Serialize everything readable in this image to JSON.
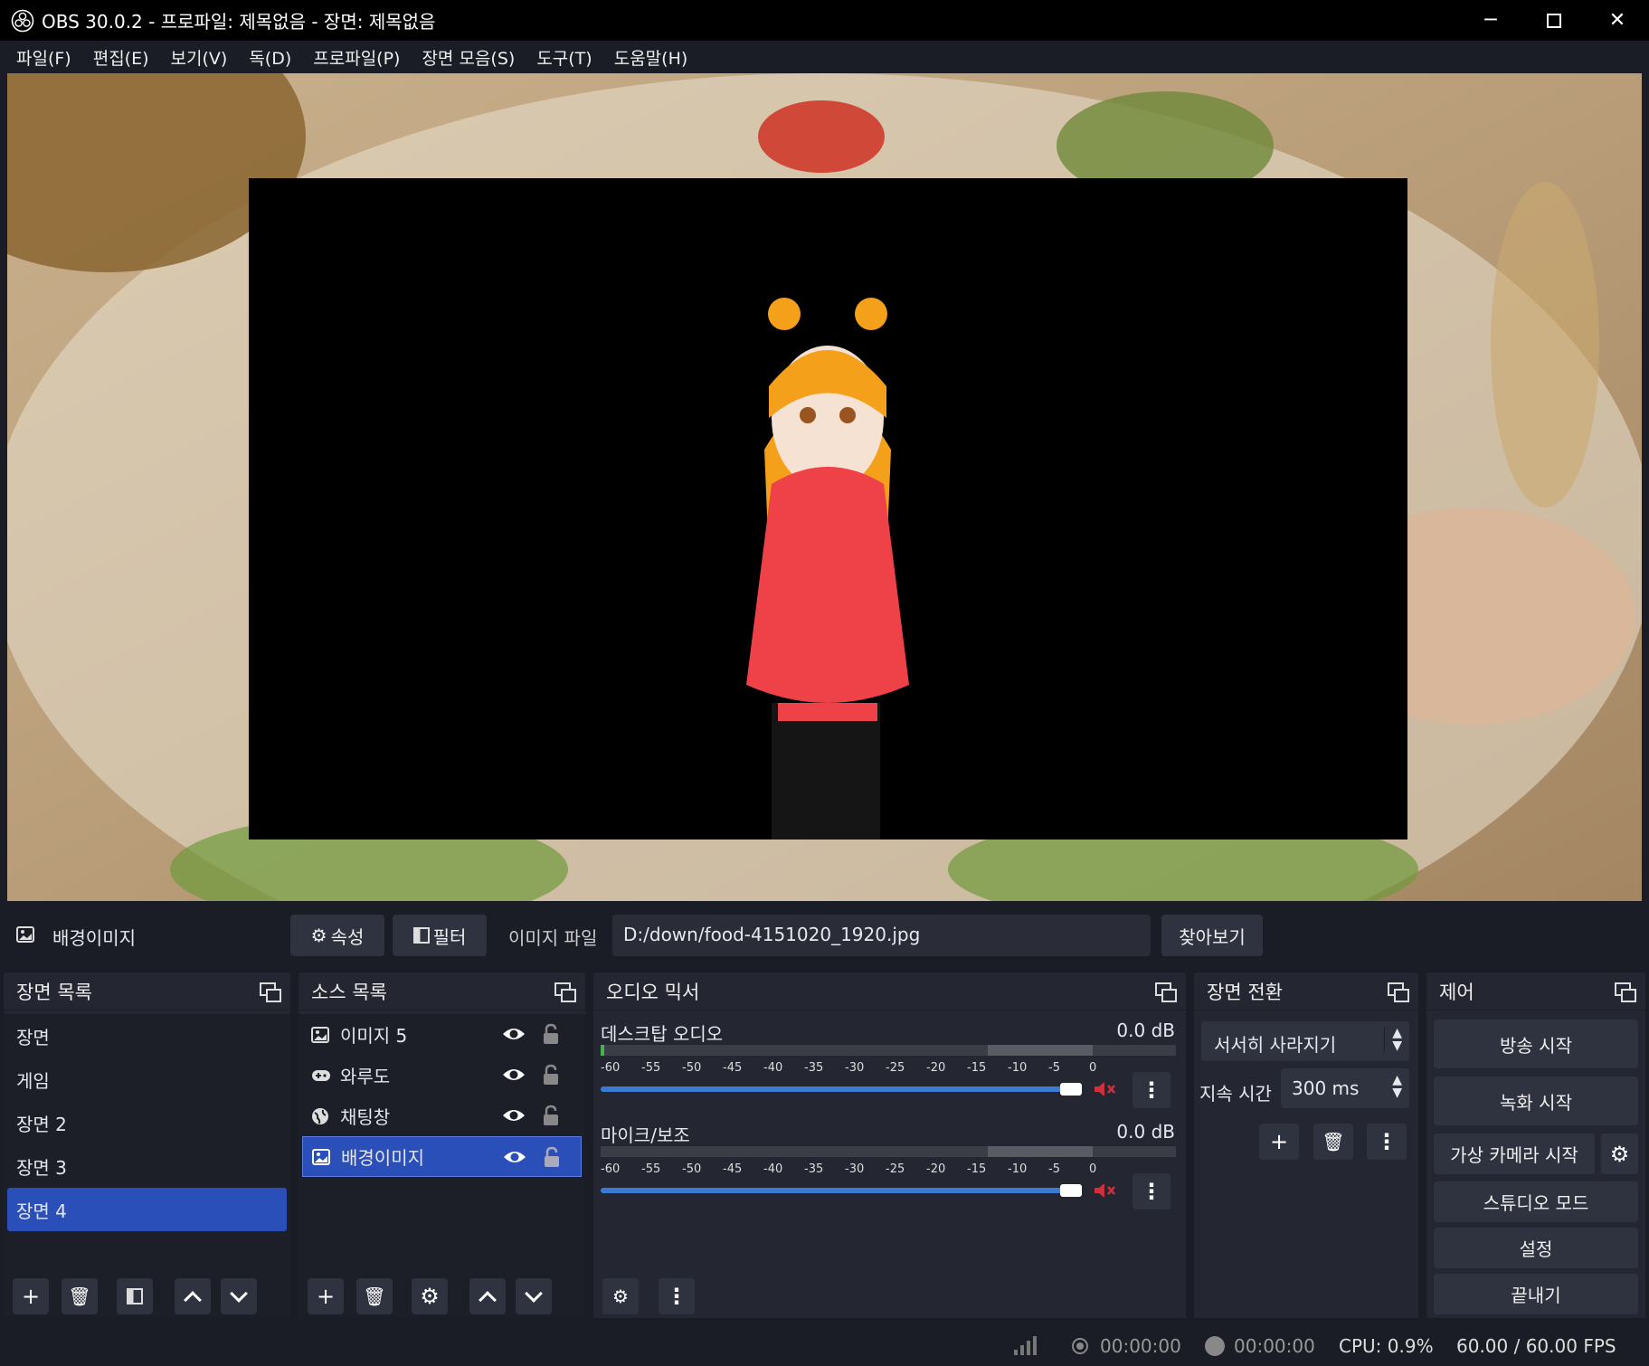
{
  "window": {
    "title": "OBS 30.0.2 - 프로파일: 제목없음 - 장면: 제목없음"
  },
  "menu": [
    "파일(F)",
    "편집(E)",
    "보기(V)",
    "독(D)",
    "프로파일(P)",
    "장면 모음(S)",
    "도구(T)",
    "도움말(H)"
  ],
  "source_bar": {
    "selected_source": "배경이미지",
    "properties_label": "속성",
    "filters_label": "필터",
    "file_label": "이미지 파일",
    "file_path": "D:/down/food-4151020_1920.jpg",
    "browse_label": "찾아보기"
  },
  "scenes": {
    "title": "장면 목록",
    "items": [
      "장면",
      "게임",
      "장면 2",
      "장면 3",
      "장면 4"
    ],
    "selected": "장면 4"
  },
  "sources": {
    "title": "소스 목록",
    "items": [
      {
        "label": "이미지 5",
        "icon": "image-icon"
      },
      {
        "label": "와루도",
        "icon": "gamepad-icon"
      },
      {
        "label": "채팅창",
        "icon": "globe-icon"
      },
      {
        "label": "배경이미지",
        "icon": "image-icon"
      }
    ],
    "selected": "배경이미지"
  },
  "mixer": {
    "title": "오디오 믹서",
    "scale": [
      "-60",
      "-55",
      "-50",
      "-45",
      "-40",
      "-35",
      "-30",
      "-25",
      "-20",
      "-15",
      "-10",
      "-5",
      "0"
    ],
    "channels": [
      {
        "name": "데스크탑 오디오",
        "db": "0.0 dB"
      },
      {
        "name": "마이크/보조",
        "db": "0.0 dB"
      }
    ]
  },
  "transitions": {
    "title": "장면 전환",
    "selected": "서서히 사라지기",
    "duration_label": "지속 시간",
    "duration_value": "300 ms"
  },
  "controls": {
    "title": "제어",
    "start_streaming": "방송 시작",
    "start_recording": "녹화 시작",
    "virtual_camera": "가상 카메라 시작",
    "studio_mode": "스튜디오 모드",
    "settings": "설정",
    "exit": "끝내기"
  },
  "status": {
    "stream_time": "00:00:00",
    "record_time": "00:00:00",
    "cpu": "CPU: 0.9%",
    "fps": "60.00 / 60.00 FPS"
  },
  "colors": {
    "accent": "#2b4fb8",
    "slider": "#3a7bd5",
    "mute": "#d0303a"
  }
}
